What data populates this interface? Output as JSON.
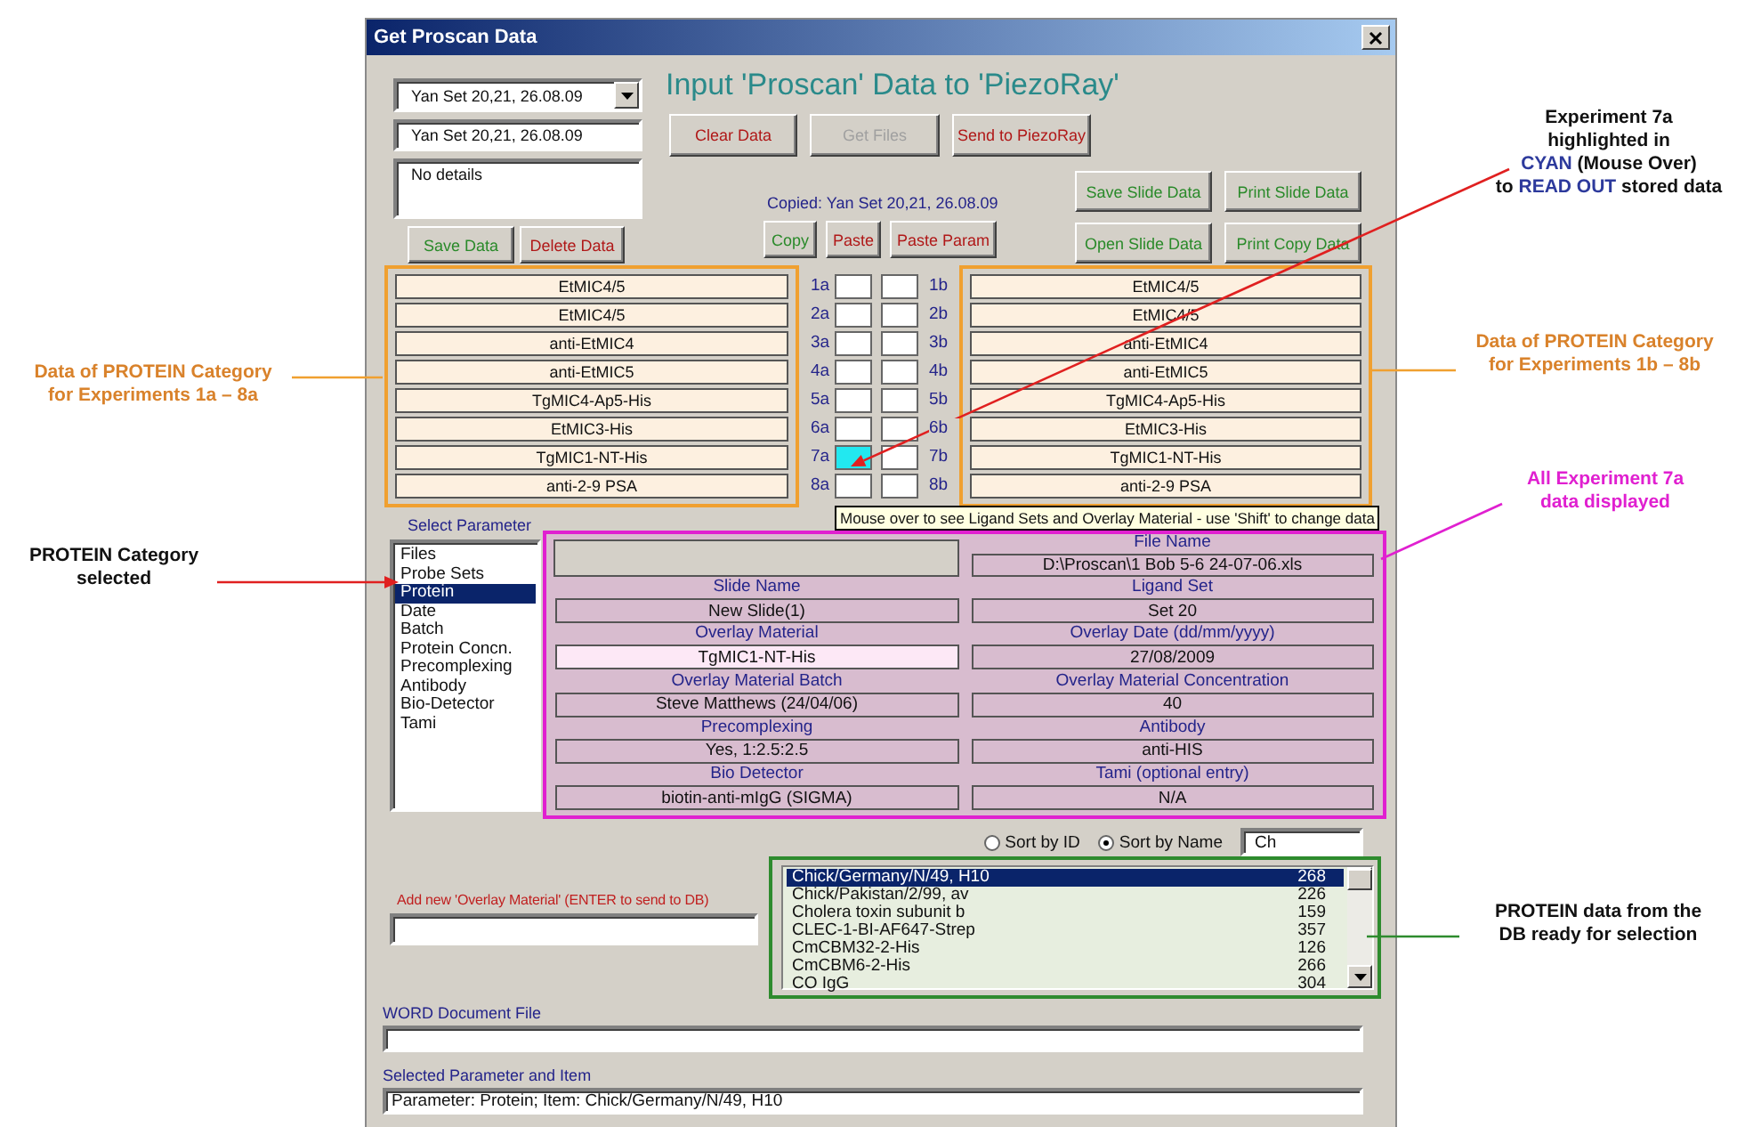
{
  "window": {
    "title": "Get Proscan Data"
  },
  "heading": "Input 'Proscan' Data to 'PiezoRay'",
  "dataset": {
    "combo": "Yan Set 20,21, 26.08.09",
    "name": "Yan Set 20,21, 26.08.09",
    "details": "No details"
  },
  "dataset_buttons": [
    {
      "label": "Save Data",
      "color": "#2a8a2a",
      "disabled": false
    },
    {
      "label": "Delete Data",
      "color": "#b01818",
      "disabled": false
    }
  ],
  "action_buttons": [
    {
      "label": "Clear Data",
      "color": "#b01818",
      "disabled": false
    },
    {
      "label": "Get Files",
      "disabled": true
    },
    {
      "label": "Send to PiezoRay",
      "color": "#b01818",
      "disabled": false
    }
  ],
  "copied_text": "Copied: Yan Set 20,21, 26.08.09",
  "copy_buttons": [
    {
      "label": "Copy",
      "color": "#2a8a2a",
      "disabled": false
    },
    {
      "label": "Paste",
      "color": "#b01818",
      "disabled": false
    },
    {
      "label": "Paste Param",
      "color": "#b01818",
      "disabled": false
    }
  ],
  "slide_buttons": [
    {
      "label": "Save Slide Data",
      "color": "#2a8a2a",
      "disabled": false
    },
    {
      "label": "Print Slide Data",
      "color": "#2a8a2a",
      "disabled": false
    },
    {
      "label": "Open Slide Data",
      "color": "#2a8a2a",
      "disabled": false
    },
    {
      "label": "Print Copy Data",
      "color": "#2a8a2a",
      "disabled": false
    }
  ],
  "experiments": [
    {
      "a": {
        "label": "1a",
        "value": "EtMIC4/5",
        "highlighted": false
      },
      "b": {
        "label": "1b",
        "value": "EtMIC4/5",
        "highlighted": false
      }
    },
    {
      "a": {
        "label": "2a",
        "value": "EtMIC4/5",
        "highlighted": false
      },
      "b": {
        "label": "2b",
        "value": "EtMIC4/5",
        "highlighted": false
      }
    },
    {
      "a": {
        "label": "3a",
        "value": "anti-EtMIC4",
        "highlighted": false
      },
      "b": {
        "label": "3b",
        "value": "anti-EtMIC4",
        "highlighted": false
      }
    },
    {
      "a": {
        "label": "4a",
        "value": "anti-EtMIC5",
        "highlighted": false
      },
      "b": {
        "label": "4b",
        "value": "anti-EtMIC5",
        "highlighted": false
      }
    },
    {
      "a": {
        "label": "5a",
        "value": "TgMIC4-Ap5-His",
        "highlighted": false
      },
      "b": {
        "label": "5b",
        "value": "TgMIC4-Ap5-His",
        "highlighted": false
      }
    },
    {
      "a": {
        "label": "6a",
        "value": "EtMIC3-His",
        "highlighted": false
      },
      "b": {
        "label": "6b",
        "value": "EtMIC3-His",
        "highlighted": false
      }
    },
    {
      "a": {
        "label": "7a",
        "value": "TgMIC1-NT-His",
        "highlighted": true
      },
      "b": {
        "label": "7b",
        "value": "TgMIC1-NT-His",
        "highlighted": false
      }
    },
    {
      "a": {
        "label": "8a",
        "value": "anti-2-9 PSA",
        "highlighted": false
      },
      "b": {
        "label": "8b",
        "value": "anti-2-9 PSA",
        "highlighted": false
      }
    }
  ],
  "tooltip": "Mouse over to see Ligand Sets and Overlay Material - use 'Shift' to change data",
  "parameter_list": {
    "label": "Select Parameter",
    "items": [
      {
        "label": "Files",
        "selected": false
      },
      {
        "label": "Probe Sets",
        "selected": false
      },
      {
        "label": "Protein",
        "selected": true
      },
      {
        "label": "Date",
        "selected": false
      },
      {
        "label": "Batch",
        "selected": false
      },
      {
        "label": "Protein Concn.",
        "selected": false
      },
      {
        "label": "Precomplexing",
        "selected": false
      },
      {
        "label": "Antibody",
        "selected": false
      },
      {
        "label": "Bio-Detector",
        "selected": false
      },
      {
        "label": "Tami",
        "selected": false
      }
    ]
  },
  "details": [
    {
      "kind": "blank"
    },
    {
      "kind": "field",
      "label": "File Name",
      "value": "D:\\Proscan\\1 Bob 5-6 24-07-06.xls",
      "highlighted": false
    },
    {
      "kind": "field",
      "label": "Slide Name",
      "value": "New Slide(1)",
      "highlighted": false
    },
    {
      "kind": "field",
      "label": "Ligand Set",
      "value": "Set 20",
      "highlighted": false
    },
    {
      "kind": "field",
      "label": "Overlay Material",
      "value": "TgMIC1-NT-His",
      "highlighted": true
    },
    {
      "kind": "field",
      "label": "Overlay Date (dd/mm/yyyy)",
      "value": "27/08/2009",
      "highlighted": false
    },
    {
      "kind": "field",
      "label": "Overlay Material Batch",
      "value": "Steve Matthews (24/04/06)",
      "highlighted": false
    },
    {
      "kind": "field",
      "label": "Overlay Material Concentration",
      "value": "40",
      "highlighted": false
    },
    {
      "kind": "field",
      "label": "Precomplexing",
      "value": "Yes, 1:2.5:2.5",
      "highlighted": false
    },
    {
      "kind": "field",
      "label": "Antibody",
      "value": "anti-HIS",
      "highlighted": false
    },
    {
      "kind": "field",
      "label": "Bio Detector",
      "value": "biotin-anti-mIgG (SIGMA)",
      "highlighted": false
    },
    {
      "kind": "field",
      "label": "Tami (optional entry)",
      "value": "N/A",
      "highlighted": false
    }
  ],
  "sort": {
    "options": [
      {
        "label": "Sort by ID",
        "selected": false
      },
      {
        "label": "Sort by Name",
        "selected": true
      }
    ],
    "filter": "Ch"
  },
  "add_new": {
    "label": "Add new 'Overlay Material' (ENTER to send to DB)"
  },
  "db_list": [
    {
      "name": "Chick/Germany/N/49, H10",
      "id": "268",
      "selected": true
    },
    {
      "name": "Chick/Pakistan/2/99, av",
      "id": "226",
      "selected": false
    },
    {
      "name": "Cholera toxin subunit b",
      "id": "159",
      "selected": false
    },
    {
      "name": "CLEC-1-BI-AF647-Strep",
      "id": "357",
      "selected": false
    },
    {
      "name": "CmCBM32-2-His",
      "id": "126",
      "selected": false
    },
    {
      "name": "CmCBM6-2-His",
      "id": "266",
      "selected": false
    },
    {
      "name": "CO IgG",
      "id": "304",
      "selected": false
    }
  ],
  "word_file": {
    "label": "WORD Document File"
  },
  "selection": {
    "label": "Selected Parameter and Item",
    "value": "Parameter: Protein; Item: Chick/Germany/N/49, H10"
  },
  "annotations": [
    {
      "color": "#d9822b",
      "segments": [
        {
          "text": "Data of PROTEIN Category\nfor Experiments 1a – 8a",
          "accent": false
        }
      ]
    },
    {
      "color": "#111111",
      "segments": [
        {
          "text": "PROTEIN Category\nselected",
          "accent": false
        }
      ]
    },
    {
      "color": "#111111",
      "segments": [
        {
          "text": "Experiment 7a\nhighlighted in\n",
          "accent": false
        },
        {
          "text": "CYAN",
          "accent": true
        },
        {
          "text": " (Mouse Over)\nto ",
          "accent": false
        },
        {
          "text": "READ OUT",
          "accent": true
        },
        {
          "text": " stored data",
          "accent": false
        }
      ]
    },
    {
      "color": "#d9822b",
      "segments": [
        {
          "text": "Data of PROTEIN Category\nfor Experiments 1b – 8b",
          "accent": false
        }
      ]
    },
    {
      "color": "#e020d0",
      "segments": [
        {
          "text": "All Experiment 7a\ndata displayed",
          "accent": false
        }
      ]
    },
    {
      "color": "#111111",
      "segments": [
        {
          "text": "PROTEIN data from the\nDB ready for selection",
          "accent": false
        }
      ]
    }
  ]
}
